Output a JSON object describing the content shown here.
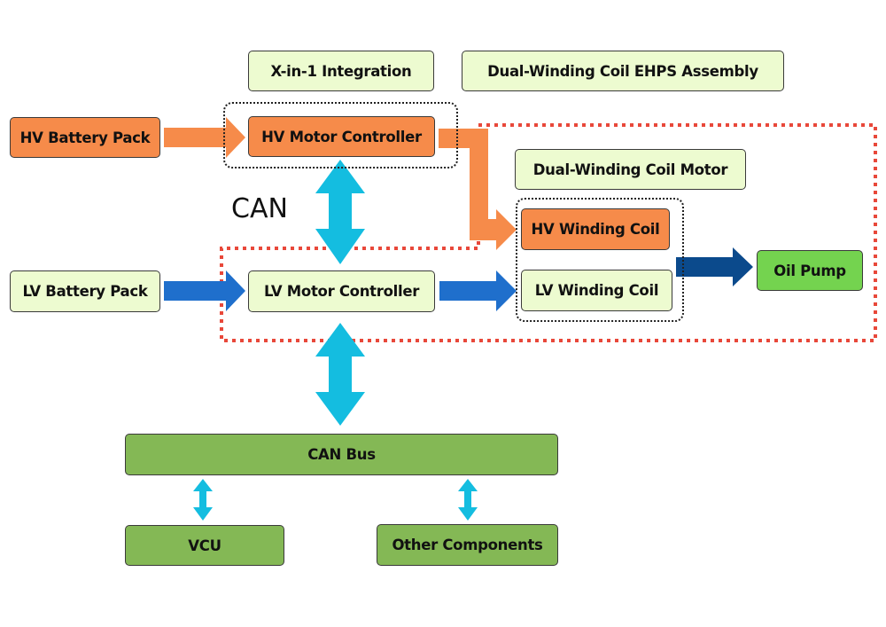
{
  "diagram": {
    "headers": {
      "xin1": "X-in-1 Integration",
      "ehps": "Dual-Winding Coil EHPS Assembly",
      "motor": "Dual-Winding Coil Motor"
    },
    "nodes": {
      "hv_battery": "HV Battery Pack",
      "hv_controller": "HV Motor Controller",
      "lv_battery": "LV Battery Pack",
      "lv_controller": "LV Motor Controller",
      "hv_coil": "HV Winding Coil",
      "lv_coil": "LV Winding Coil",
      "oil_pump": "Oil Pump",
      "can_bus": "CAN Bus",
      "vcu": "VCU",
      "other": "Other Components"
    },
    "labels": {
      "can": "CAN"
    },
    "colors": {
      "hv_orange": "#f68b4a",
      "light_green": "#edfbd0",
      "bus_green": "#84b855",
      "pump_green": "#74d34f",
      "lv_blue": "#1f6fcc",
      "dark_blue": "#0b4a8c",
      "can_cyan": "#14bde0",
      "assembly_red": "#e8483a"
    }
  }
}
